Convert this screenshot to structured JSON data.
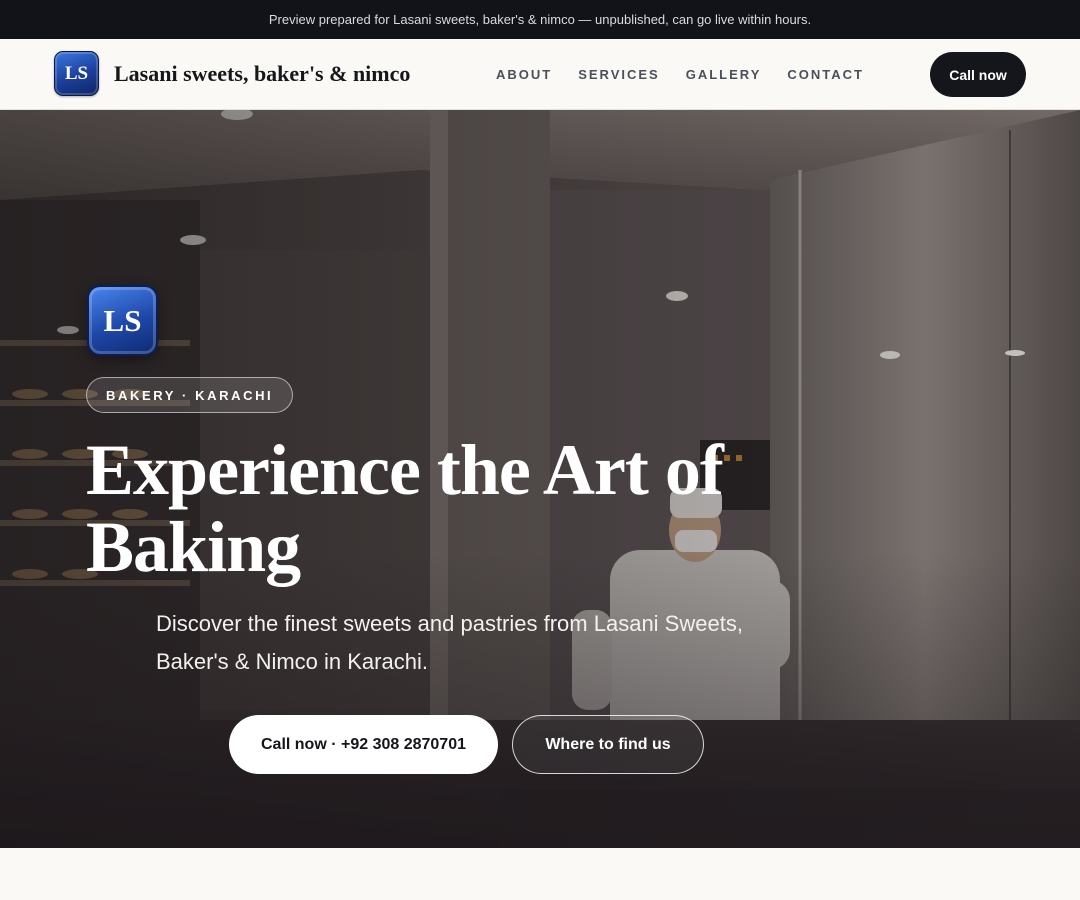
{
  "announcement": "Preview prepared for Lasani sweets, baker's & nimco — unpublished, can go live within hours.",
  "header": {
    "logo_text": "LS",
    "brand_name": "Lasani sweets, baker's & nimco",
    "nav": [
      "ABOUT",
      "SERVICES",
      "GALLERY",
      "CONTACT"
    ],
    "call_button": "Call now"
  },
  "hero": {
    "logo_text": "LS",
    "badge": "BAKERY · KARACHI",
    "title": "Experience the Art of Baking",
    "subtitle": "Discover the finest sweets and pastries from Lasani Sweets, Baker's & Nimco in Karachi.",
    "primary_button": "Call now · +92 308 2870701",
    "secondary_button": "Where to find us"
  },
  "colors": {
    "topbar_bg": "#111318",
    "header_bg": "#faf9f6",
    "dark_button": "#14161b",
    "logo_blue": "#1e47a8"
  }
}
